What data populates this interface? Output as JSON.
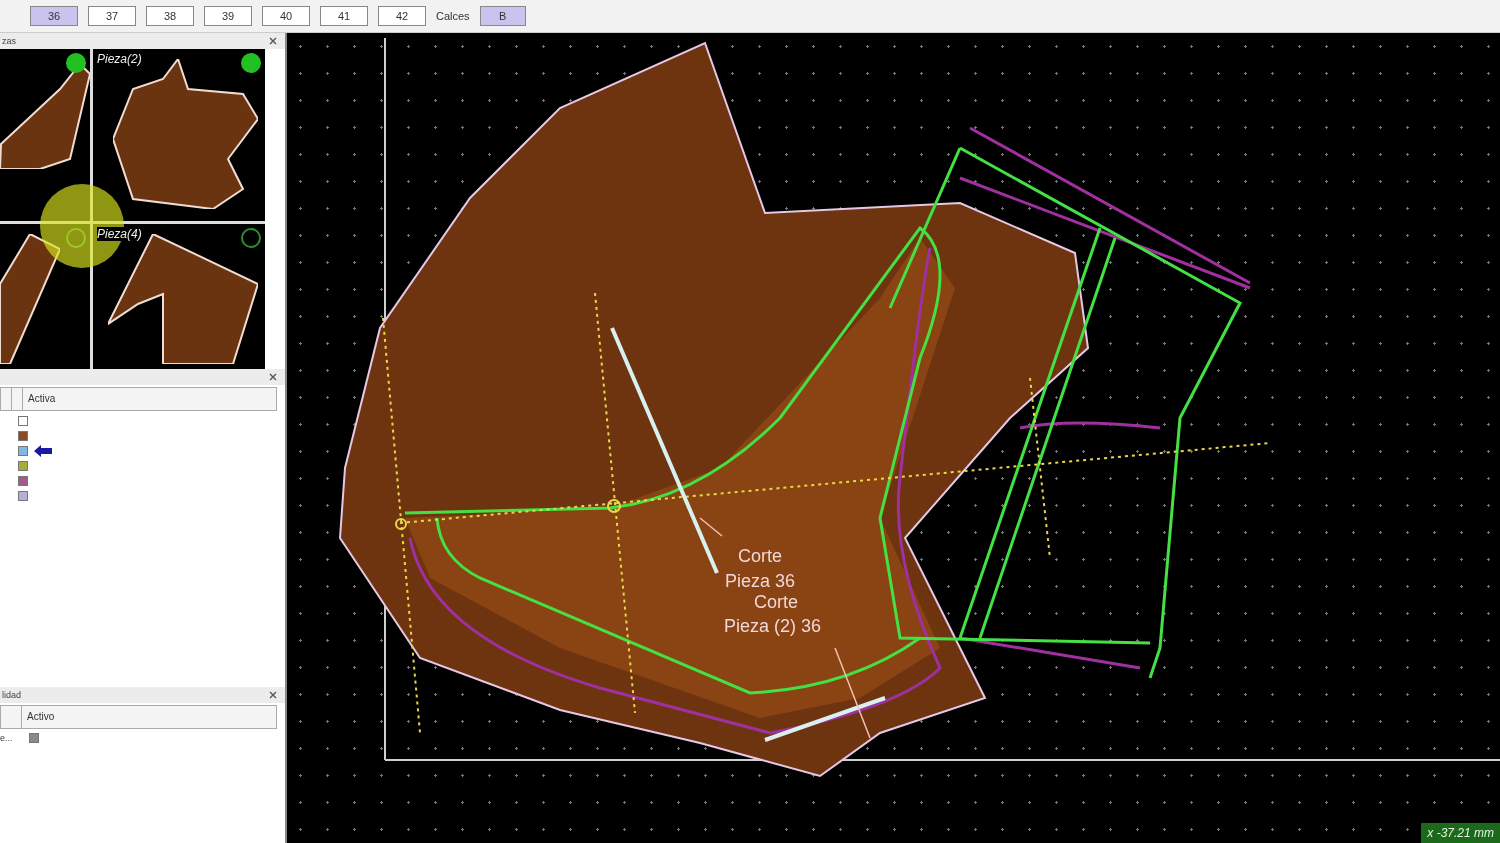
{
  "toolbar": {
    "sizes": [
      {
        "label": "36",
        "selected": true
      },
      {
        "label": "37",
        "selected": false
      },
      {
        "label": "38",
        "selected": false
      },
      {
        "label": "39",
        "selected": false
      },
      {
        "label": "40",
        "selected": false
      },
      {
        "label": "41",
        "selected": false
      },
      {
        "label": "42",
        "selected": false
      }
    ],
    "calces_label": "Calces",
    "calces_button": {
      "label": "B",
      "selected": true
    }
  },
  "pieces_panel": {
    "title": "zas",
    "thumbnails": [
      {
        "active": true
      },
      {
        "label": "Pieza(2)",
        "active": true
      },
      {
        "active": false
      },
      {
        "label": "Pieza(4)",
        "active": false
      }
    ]
  },
  "layers_panel": {
    "column": "Activa",
    "rows": [
      {
        "color": "#ffffff",
        "selected": false
      },
      {
        "color": "#8b4a22",
        "selected": false
      },
      {
        "color": "#7fb8e0",
        "selected": true
      },
      {
        "color": "#a8ad3a",
        "selected": false
      },
      {
        "color": "#a05a8a",
        "selected": false
      },
      {
        "color": "#b9aed6",
        "selected": false
      }
    ]
  },
  "quality_panel": {
    "title": "lidad",
    "column": "Activo",
    "rows": [
      {
        "name": "e...",
        "color": "#8a8a8a"
      }
    ]
  },
  "canvas": {
    "labels": [
      "Corte",
      "Pieza 36",
      "Corte",
      "Pieza (2) 36"
    ],
    "coordinate": "x -37.21 mm"
  }
}
